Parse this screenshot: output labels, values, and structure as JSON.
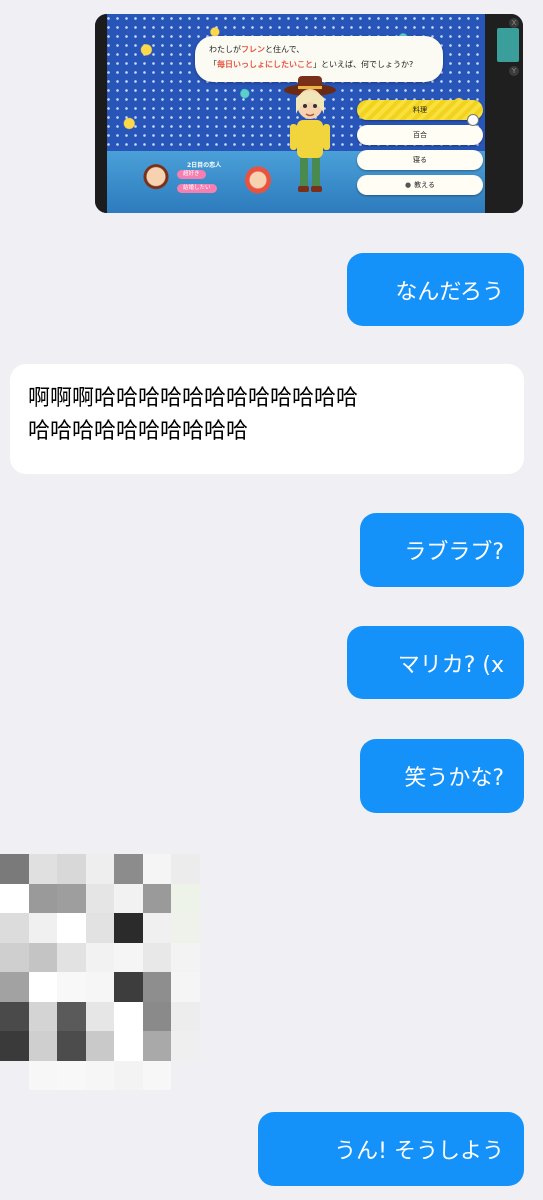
{
  "screenshot": {
    "question_prefix": "わたしが",
    "question_name": "フレン",
    "question_suffix": "と住んで、",
    "question_open": "「",
    "question_highlight": "毎日いっしょにしたいこと",
    "question_close": "」といえば、何でしょうか?",
    "choices": [
      {
        "label": "料理"
      },
      {
        "label": "百合"
      },
      {
        "label": "寝る"
      },
      {
        "label": "教える"
      }
    ],
    "relation_title": "2日目の恋人",
    "relation_tags": [
      "超好き",
      "結婚したい"
    ],
    "colors": {
      "bg": "#2855b8",
      "accent": "#e8523f",
      "selected": "#f8e13c",
      "tag": "#f57fb0"
    }
  },
  "messages": [
    {
      "side": "out",
      "text": "なんだろう"
    },
    {
      "side": "in",
      "line1": "啊啊啊哈哈哈哈哈哈哈哈哈哈哈哈",
      "line2": "哈哈哈哈哈哈哈哈哈哈"
    },
    {
      "side": "out",
      "text": "ラブラブ?"
    },
    {
      "side": "out",
      "text": "マリカ? (x"
    },
    {
      "side": "out",
      "text": "笑うかな?"
    },
    {
      "side": "out",
      "text": "うん! そうしよう"
    }
  ],
  "theme": {
    "chat_bg": "#efeff4",
    "outgoing_bubble": "#1592f9",
    "incoming_bubble": "#ffffff"
  }
}
